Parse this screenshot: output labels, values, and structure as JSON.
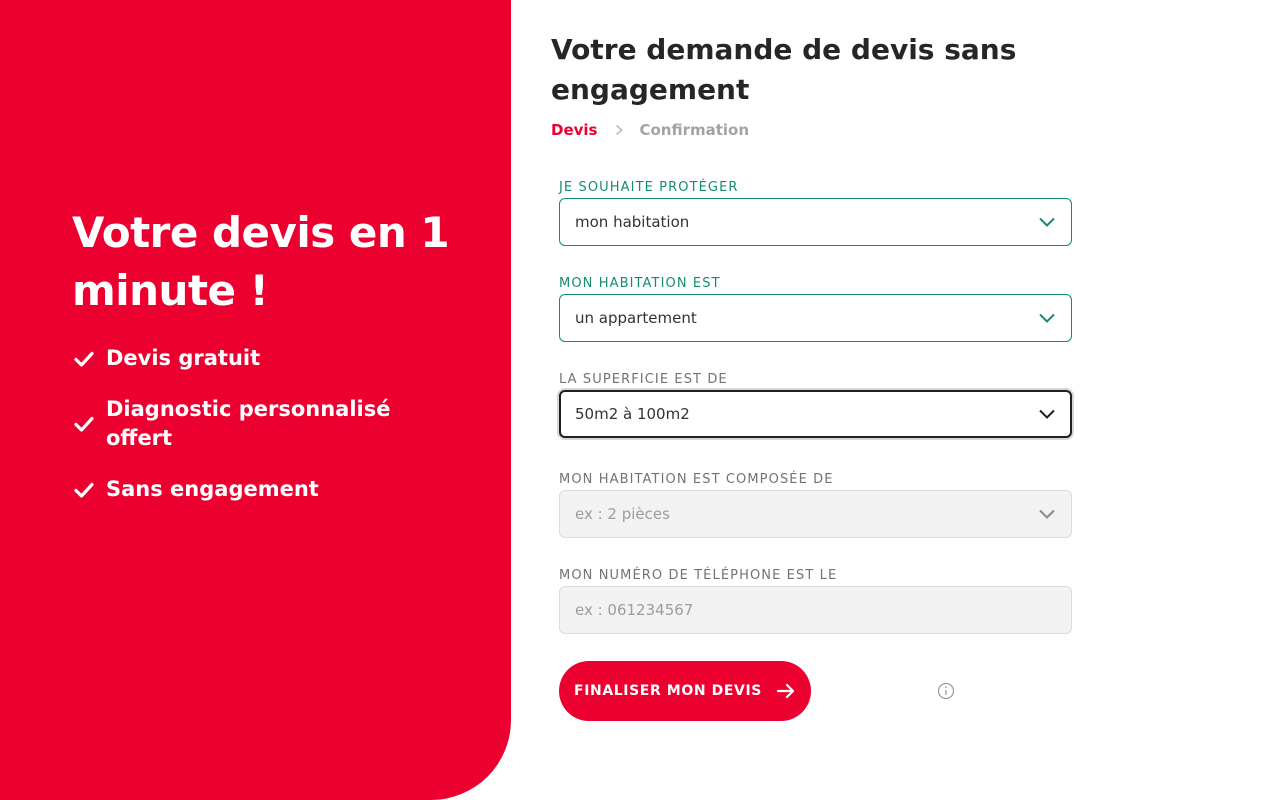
{
  "hero": {
    "title": "Votre devis en 1 minute !",
    "benefits": [
      "Devis gratuit",
      "Diagnostic personnalisé offert",
      "Sans engagement"
    ]
  },
  "form": {
    "title": "Votre demande de devis sans engagement",
    "steps": {
      "current": "Devis",
      "next": "Confirmation"
    },
    "fields": [
      {
        "label": "JE SOUHAITE PROTÉGER",
        "value": "mon habitation",
        "type": "select",
        "state": "filled"
      },
      {
        "label": "MON HABITATION EST",
        "value": "un appartement",
        "type": "select",
        "state": "filled"
      },
      {
        "label": "LA SUPERFICIE EST DE",
        "value": "50m2 à 100m2",
        "type": "select",
        "state": "focused"
      },
      {
        "label": "MON HABITATION EST COMPOSÉE DE",
        "placeholder": "ex : 2 pièces",
        "type": "select",
        "state": "disabled"
      },
      {
        "label": "MON NUMÉRO DE TÉLÉPHONE EST LE",
        "placeholder": "ex : 061234567",
        "type": "text",
        "state": "disabled"
      }
    ],
    "submit_label": "FINALISER MON DEVIS"
  },
  "colors": {
    "brand": "#ec0030",
    "valid": "#168b72",
    "text": "#262626",
    "muted": "#a3a3a3"
  },
  "icons": {
    "benefit": "check-icon",
    "step_separator": "chevron-right-icon",
    "select": "chevron-down-icon",
    "submit": "arrow-right-icon",
    "info": "info-icon"
  }
}
